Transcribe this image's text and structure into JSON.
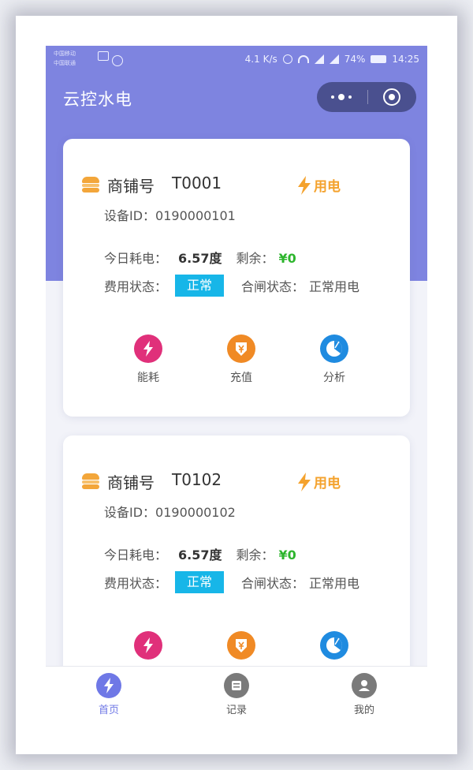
{
  "status_bar": {
    "carrier_line1": "中国移动",
    "carrier_line2": "中国联通",
    "speed": "4.1 K/s",
    "battery": "74%",
    "time": "14:25"
  },
  "app": {
    "title": "云控水电"
  },
  "labels": {
    "shop_prefix": "商铺号",
    "power": "用电",
    "today_usage_label": "今日耗电：",
    "remaining_label": "剩余：",
    "fee_status_label": "费用状态：",
    "gate_status_label": "合闸状态：",
    "actions": [
      "能耗",
      "充值",
      "分析"
    ]
  },
  "cards": [
    {
      "shop_id": "T0001",
      "device": "设备ID：0190000101",
      "today_usage": "6.57度",
      "remaining": "¥0",
      "fee_status": "正常",
      "gate_status": "正常用电"
    },
    {
      "shop_id": "T0102",
      "device": "设备ID：0190000102",
      "today_usage": "6.57度",
      "remaining": "¥0",
      "fee_status": "正常",
      "gate_status": "正常用电"
    }
  ],
  "tabs": [
    {
      "label": "首页",
      "icon": "bolt-icon",
      "active": true
    },
    {
      "label": "记录",
      "icon": "records-icon",
      "active": false
    },
    {
      "label": "我的",
      "icon": "user-icon",
      "active": false
    }
  ],
  "colors": {
    "header": "#7e84e0",
    "accent": "#6f78e6",
    "power": "#f4a22d",
    "badge": "#17b6e8",
    "remaining": "#2db52d"
  }
}
